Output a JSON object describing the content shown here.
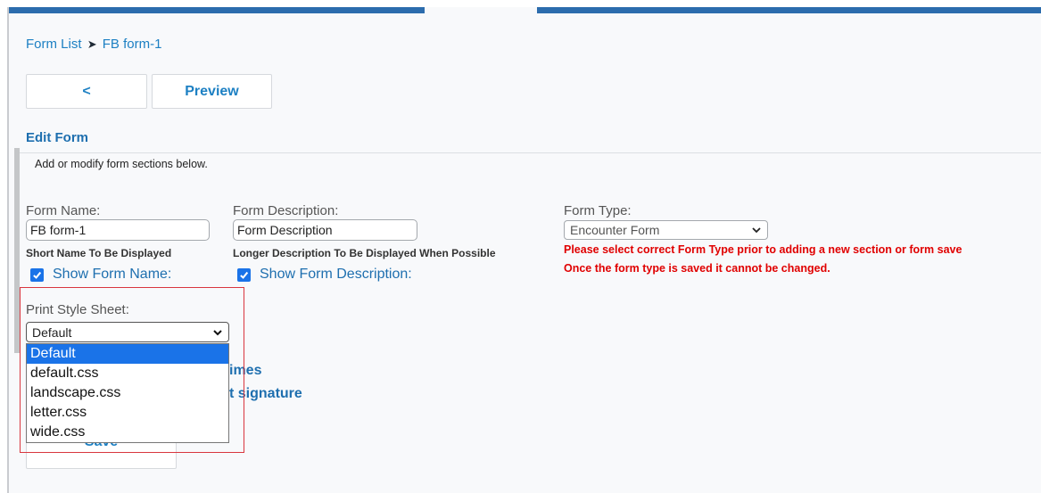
{
  "breadcrumb": {
    "parent": "Form List",
    "separator": "➤",
    "current": "FB form-1"
  },
  "toolbar": {
    "back_label": "<",
    "preview_label": "Preview"
  },
  "section": {
    "title": "Edit Form",
    "subtitle": "Add or modify form sections below."
  },
  "form_name": {
    "label": "Form Name:",
    "value": "FB form-1",
    "hint": "Short Name To Be Displayed",
    "show_label": "Show Form Name:",
    "show_checked": true
  },
  "form_description": {
    "label": "Form Description:",
    "value": "Form Description",
    "hint": "Longer Description To Be Displayed When Possible",
    "show_label": "Show Form Description:",
    "show_checked": true
  },
  "form_type": {
    "label": "Form Type:",
    "selected": "Encounter Form",
    "error_1": "Please select correct Form Type prior to adding a new section or form save",
    "error_2": "Once the form type is saved it cannot be changed."
  },
  "print_style": {
    "label": "Print Style Sheet:",
    "selected": "Default",
    "options": [
      "Default",
      "default.css",
      "landscape.css",
      "letter.css",
      "wide.css"
    ],
    "highlighted_index": 0
  },
  "obscured": {
    "text_1": "imes",
    "text_2": "t signature"
  },
  "save_label": "Save",
  "colors": {
    "accent": "#1d80c3",
    "topbar": "#2c6cad",
    "error": "#e00000",
    "highlight": "#1a73e8",
    "callout": "#d9363e"
  }
}
